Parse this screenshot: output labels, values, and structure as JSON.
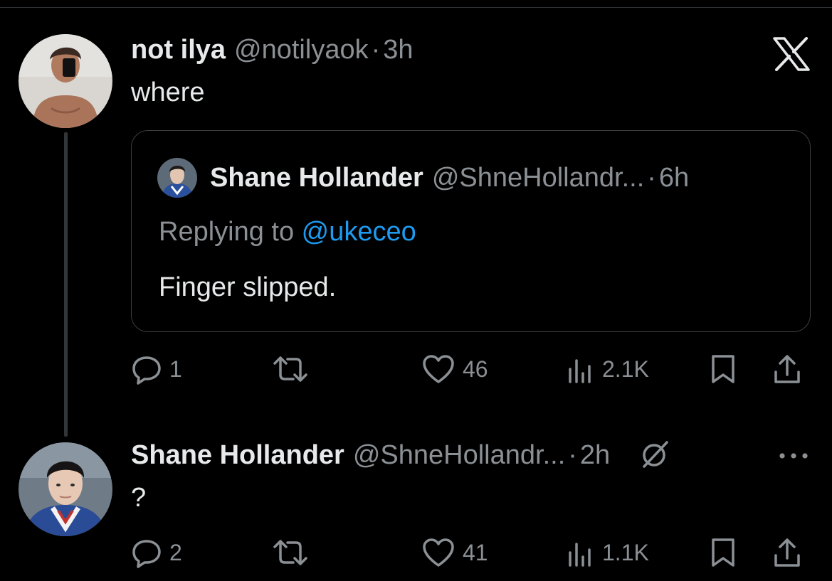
{
  "tweet1": {
    "display_name": "not ilya",
    "handle": "@notilyaok",
    "separator": "·",
    "time": "3h",
    "text": "where",
    "quote": {
      "display_name": "Shane Hollander",
      "handle": "@ShneHollandr...",
      "separator": "·",
      "time": "6h",
      "replying_prefix": "Replying to ",
      "replying_handle": "@ukeceo",
      "text": "Finger slipped."
    },
    "actions": {
      "replies": "1",
      "likes": "46",
      "views": "2.1K"
    }
  },
  "tweet2": {
    "display_name": "Shane Hollander",
    "handle": "@ShneHollandr...",
    "separator": "·",
    "time": "2h",
    "text": "?",
    "actions": {
      "replies": "2",
      "likes": "41",
      "views": "1.1K"
    }
  },
  "icons": {
    "logo": "x-logo-icon",
    "reply": "reply-icon",
    "retweet": "retweet-icon",
    "like": "heart-icon",
    "views": "views-icon",
    "bookmark": "bookmark-icon",
    "share": "share-icon",
    "grok": "grok-icon",
    "more": "more-icon"
  },
  "colors": {
    "background": "#000000",
    "text": "#e7e9ea",
    "muted": "#8b9095",
    "link": "#1d9bf0",
    "border": "#3a3d40"
  }
}
